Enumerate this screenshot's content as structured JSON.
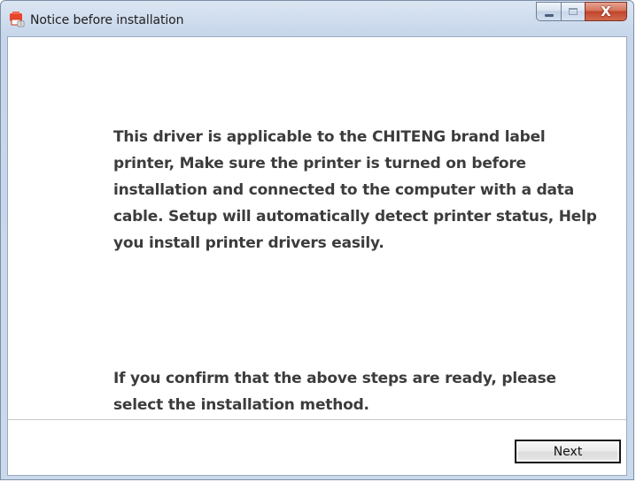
{
  "window": {
    "title": "Notice before installation",
    "icon": "printer-app-icon"
  },
  "caption_buttons": {
    "minimize_icon": "minimize-icon",
    "maximize_icon": "maximize-icon",
    "close_icon": "close-icon",
    "close_glyph": "X"
  },
  "content": {
    "description": "This driver is applicable to the CHITENG brand label printer, Make sure the printer is turned on before installation and connected to the computer with a data cable. Setup will automatically detect printer status, Help you install printer drivers easily.",
    "confirm_text": "If you confirm that the above steps are ready, please select the installation method."
  },
  "footer": {
    "next_label": "Next"
  },
  "colors": {
    "accent_icon": "#e8452c",
    "text": "#3c3c3c",
    "close_button": "#c2452b"
  }
}
